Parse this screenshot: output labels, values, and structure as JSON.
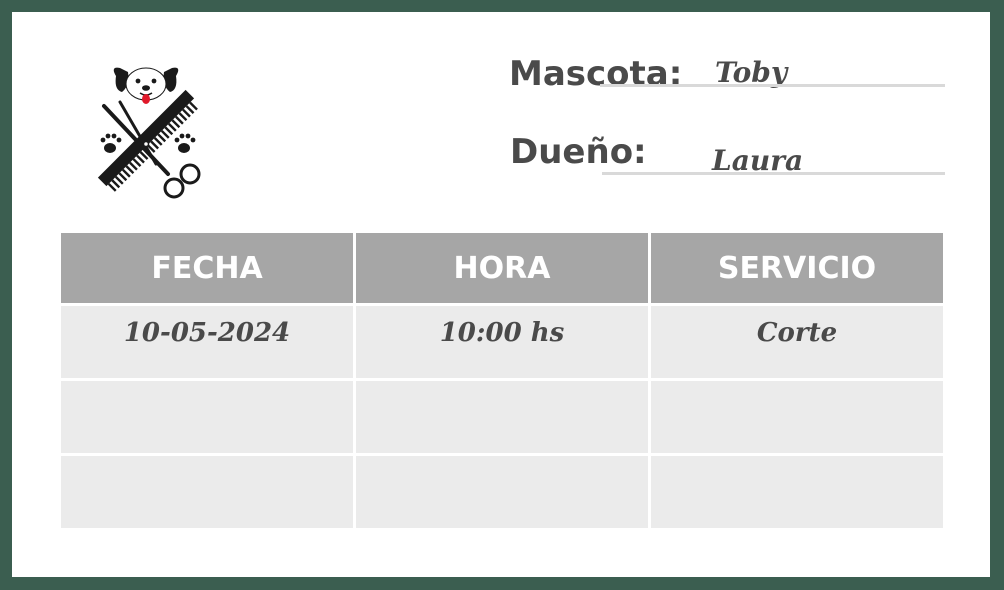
{
  "form": {
    "pet_label": "Mascota:",
    "pet_value": "Toby",
    "owner_label": "Dueño:",
    "owner_value": "Laura"
  },
  "table": {
    "headers": [
      "FECHA",
      "HORA",
      "SERVICIO"
    ],
    "rows": [
      [
        "10-05-2024",
        "10:00 hs",
        "Corte"
      ],
      [
        "",
        "",
        ""
      ],
      [
        "",
        "",
        ""
      ]
    ]
  },
  "logo": {
    "icon": "dog-grooming-logo",
    "accent_color": "#e0192a"
  },
  "colors": {
    "frame": "#3b5e50",
    "header_bg": "#a6a6a6",
    "cell_bg": "#ebebeb",
    "text": "#4a4a4a"
  }
}
